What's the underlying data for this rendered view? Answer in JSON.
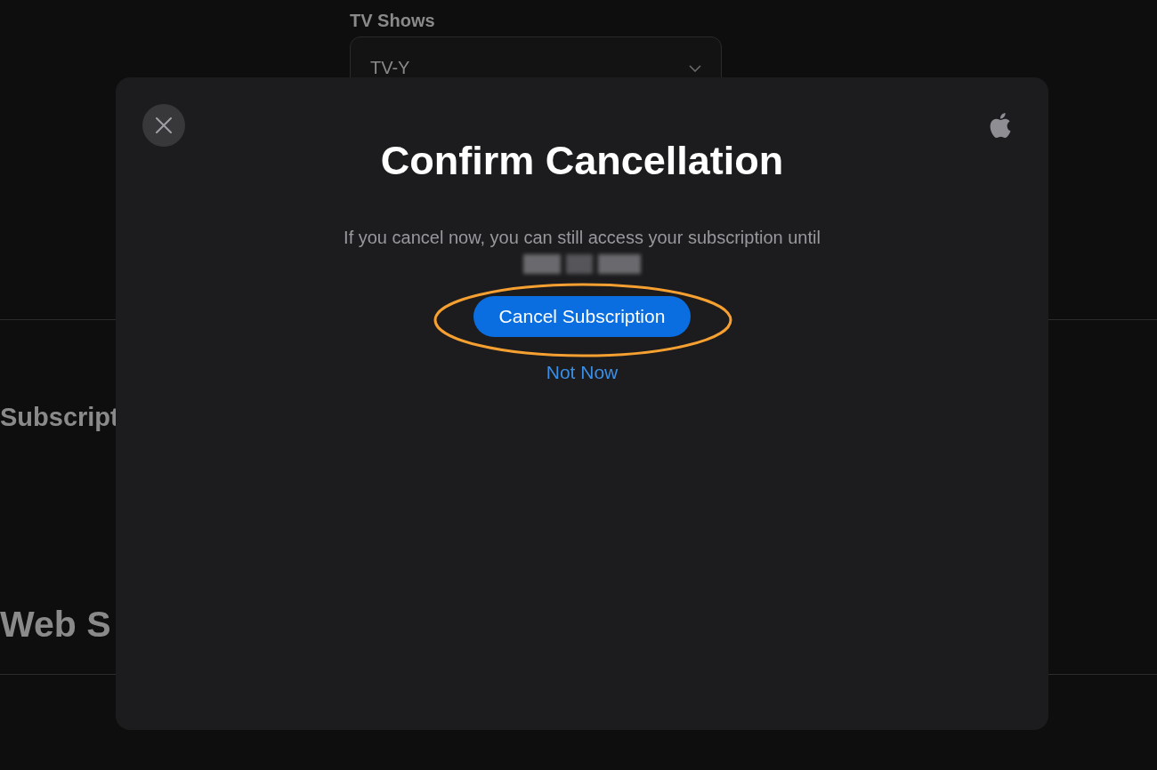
{
  "background": {
    "field_label": "TV Shows",
    "select_value": "TV-Y",
    "section_headings": [
      "Subscript",
      "Web S"
    ]
  },
  "dialog": {
    "title": "Confirm Cancellation",
    "message": "If you cancel now, you can still access your subscription until",
    "primary_button": "Cancel Subscription",
    "secondary_link": "Not Now"
  }
}
